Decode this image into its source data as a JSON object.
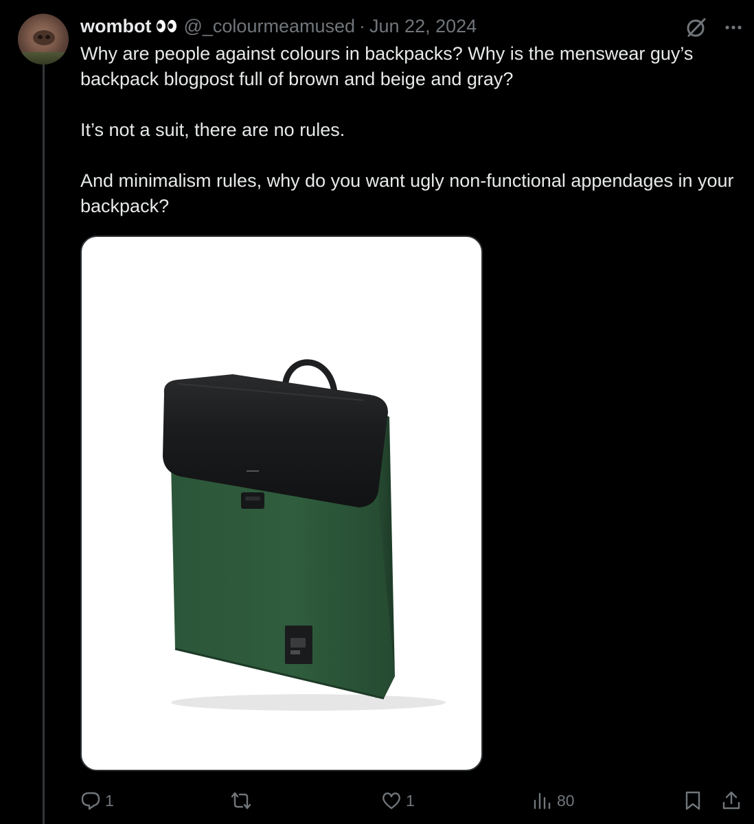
{
  "tweet": {
    "display_name": "wombot",
    "emoji": "eyes-emoji",
    "handle": "@_colourmeamused",
    "separator": "·",
    "date": "Jun 22, 2024",
    "paragraphs": [
      "Why are people against colours in backpacks? Why is the menswear guy’s backpack blogpost full of brown and beige and gray?",
      "It’s not a suit, there are no rules.",
      "And minimalism rules, why do you want ugly non-functional appendages in your backpack?"
    ],
    "media": {
      "alt": "green suede backpack with black leather flap",
      "description_icon": "backpack-image"
    }
  },
  "header_icons": {
    "grok": "grok-slash-icon",
    "more": "more-dots-icon"
  },
  "actions": {
    "reply": {
      "icon": "reply-icon",
      "count": "1"
    },
    "repost": {
      "icon": "repost-icon",
      "count": ""
    },
    "like": {
      "icon": "heart-icon",
      "count": "1"
    },
    "views": {
      "icon": "views-icon",
      "count": "80"
    },
    "bookmark": {
      "icon": "bookmark-icon"
    },
    "share": {
      "icon": "share-icon"
    }
  },
  "colors": {
    "background": "#000000",
    "text_primary": "#e7e9ea",
    "text_secondary": "#71767b",
    "thread_line": "#333639",
    "backpack_green": "#2f5a3d",
    "backpack_flap": "#1c1d1f"
  }
}
